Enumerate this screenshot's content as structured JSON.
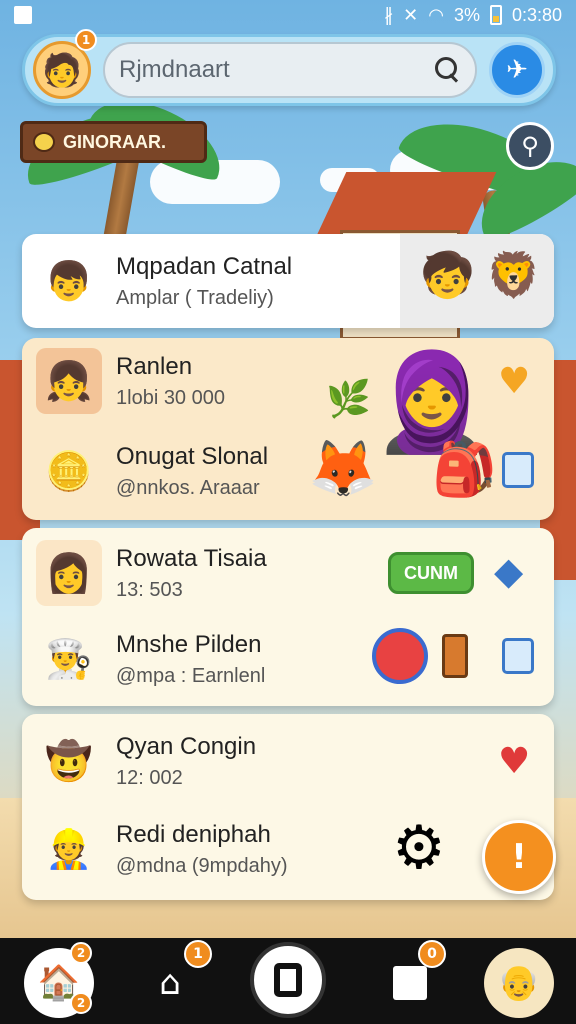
{
  "status_bar": {
    "battery": "3%",
    "time": "0:3:80"
  },
  "top_bar": {
    "avatar_badge": "1",
    "search_value": "Rjmdnaart"
  },
  "plank_label": "GINORAAR.",
  "cards": [
    {
      "rows": [
        {
          "title": "Mqpadan Catnal",
          "sub": "Amplar ( Tradeliy)"
        }
      ]
    },
    {
      "rows": [
        {
          "title": "Ranlen",
          "sub": "1lobi 30 000"
        },
        {
          "title": "Onugat Slonal",
          "sub": "@nnkos. Araaar"
        }
      ]
    },
    {
      "rows": [
        {
          "title": "Rowata Tisaia",
          "sub": "13: 503",
          "pill": "CUNM"
        },
        {
          "title": "Mnshe Pilden",
          "sub": "@mpa : Earnlenl"
        }
      ]
    },
    {
      "rows": [
        {
          "title": "Qyan Congin",
          "sub": "12: 002"
        },
        {
          "title": "Redi deniphah",
          "sub": "@mdna (9mpdahy)"
        }
      ]
    }
  ],
  "fab_label": "!",
  "bottom_nav": {
    "home_badge_top": "2",
    "home_badge_bottom": "2",
    "house_badge": "1",
    "box_badge": "0"
  }
}
